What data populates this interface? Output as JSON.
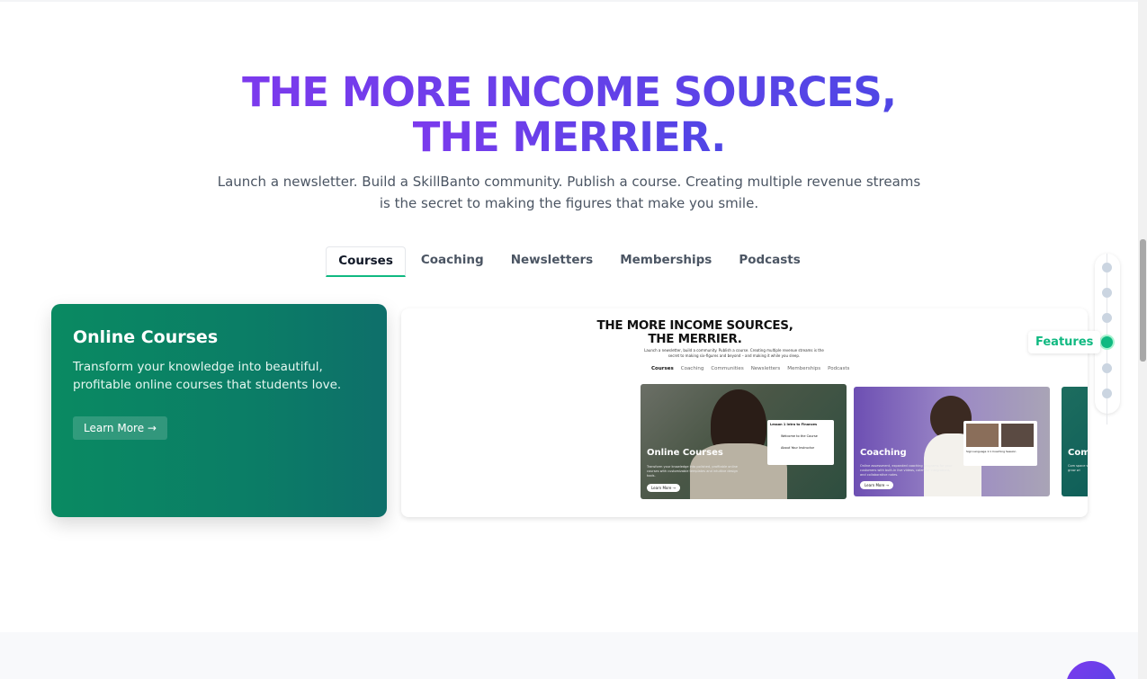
{
  "hero": {
    "title_line1": "THE MORE INCOME SOURCES,",
    "title_line2": "THE MERRIER.",
    "subtitle": "Launch a newsletter. Build a SkillBanto community. Publish a course. Creating multiple revenue streams is the secret to making the figures that make you smile."
  },
  "tabs": [
    {
      "label": "Courses",
      "active": true
    },
    {
      "label": "Coaching",
      "active": false
    },
    {
      "label": "Newsletters",
      "active": false
    },
    {
      "label": "Memberships",
      "active": false
    },
    {
      "label": "Podcasts",
      "active": false
    }
  ],
  "feature_card": {
    "title": "Online Courses",
    "description": "Transform your knowledge into beautiful, profitable online courses that students love.",
    "button": "Learn More →"
  },
  "preview": {
    "title_line1": "THE MORE INCOME SOURCES,",
    "title_line2": "THE MERRIER.",
    "subtitle": "Launch a newsletter, build a community. Publish a course. Creating multiple revenue streams is the secret to making six-figures and beyond – and making it while you sleep.",
    "tabs": [
      "Courses",
      "Coaching",
      "Communities",
      "Newsletters",
      "Memberships",
      "Podcasts"
    ],
    "cards": [
      {
        "label": "Online Courses",
        "desc": "Transform your knowledge into polished, profitable online courses with customizable templates and intuitive design tools.",
        "button": "Learn More →",
        "popup_title": "Lesson 1 Intro to Finances",
        "popup_items": [
          "Welcome to the Course",
          "About Your Instructor"
        ]
      },
      {
        "label": "Coaching",
        "desc": "Online assessment, expanded coaching programs for your customers with built-in live videos, calendar integrations, and collaborative notes.",
        "button": "Learn More →",
        "popup_title": "Sign Language 1:1 Coaching Session"
      },
      {
        "label": "Com",
        "desc": "Com space wh grow wi"
      }
    ]
  },
  "side_nav": {
    "active_label": "Features",
    "dot_count": 6,
    "active_index": 3
  },
  "colors": {
    "accent_green": "#10b981",
    "title_gradient_start": "#7c3aed",
    "title_gradient_end": "#4f46e5"
  }
}
